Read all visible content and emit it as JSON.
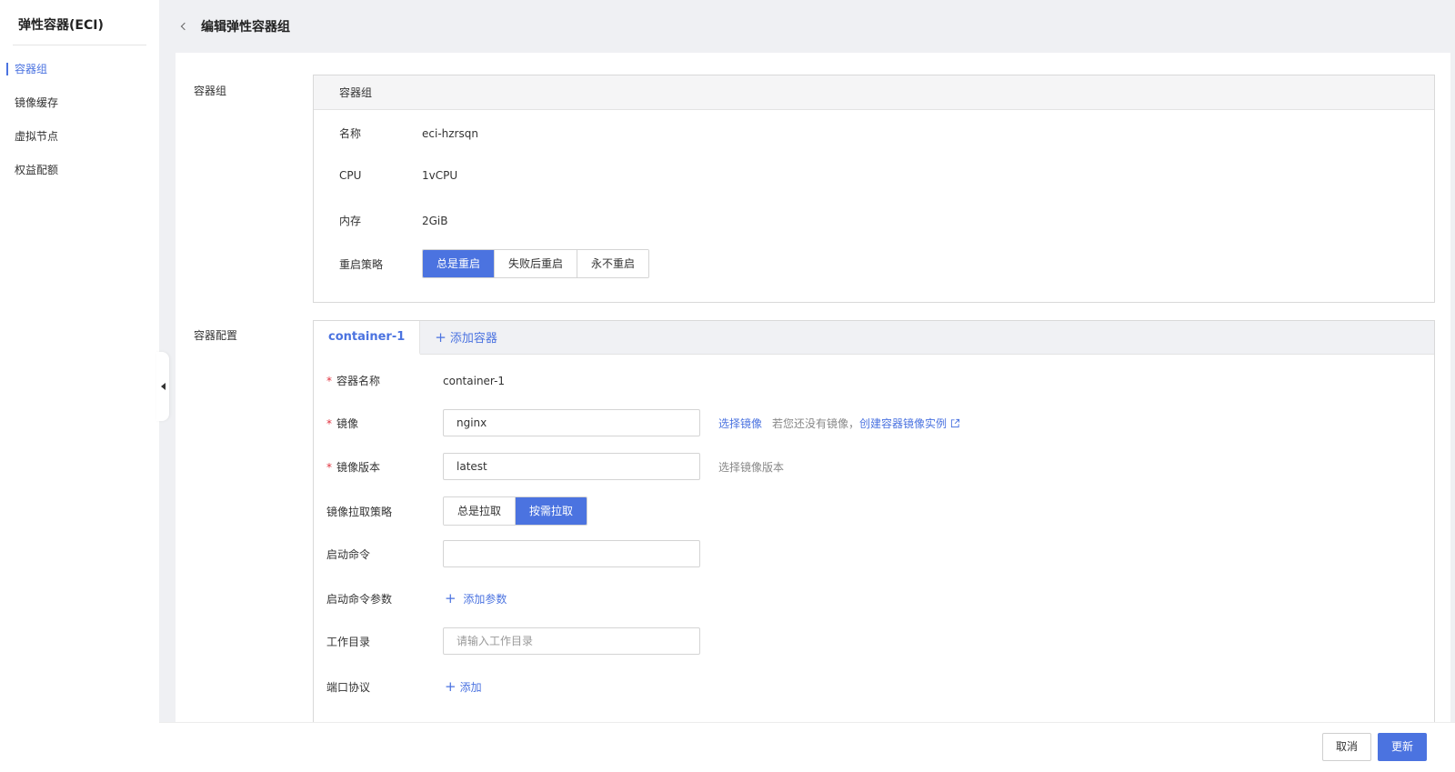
{
  "sidebar": {
    "title": "弹性容器(ECI)",
    "items": [
      {
        "label": "容器组",
        "active": true
      },
      {
        "label": "镜像缓存",
        "active": false
      },
      {
        "label": "虚拟节点",
        "active": false
      },
      {
        "label": "权益配额",
        "active": false
      }
    ]
  },
  "header": {
    "title": "编辑弹性容器组"
  },
  "group": {
    "section_label": "容器组",
    "card_title": "容器组",
    "name_label": "名称",
    "name_value": "eci-hzrsqn",
    "cpu_label": "CPU",
    "cpu_value": "1vCPU",
    "mem_label": "内存",
    "mem_value": "2GiB",
    "restart_label": "重启策略",
    "restart_options": [
      "总是重启",
      "失败后重启",
      "永不重启"
    ],
    "restart_selected": "总是重启"
  },
  "container": {
    "section_label": "容器配置",
    "tab_label": "container-1",
    "add_tab_label": "添加容器",
    "name_label": "容器名称",
    "name_value": "container-1",
    "image_label": "镜像",
    "image_value": "nginx",
    "choose_image": "选择镜像",
    "no_image_hint": "若您还没有镜像，",
    "create_repo": "创建容器镜像实例",
    "version_label": "镜像版本",
    "version_value": "latest",
    "choose_version": "选择镜像版本",
    "pull_label": "镜像拉取策略",
    "pull_options": [
      "总是拉取",
      "按需拉取"
    ],
    "pull_selected": "按需拉取",
    "cmd_label": "启动命令",
    "cmd_value": "",
    "args_label": "启动命令参数",
    "add_args": "添加参数",
    "workdir_label": "工作目录",
    "workdir_placeholder": "请输入工作目录",
    "port_label": "端口协议",
    "add_port": "添加"
  },
  "footer": {
    "cancel": "取消",
    "update": "更新"
  },
  "colors": {
    "accent": "#4b73e0",
    "required": "#e0333f",
    "background": "#eff0f3"
  }
}
